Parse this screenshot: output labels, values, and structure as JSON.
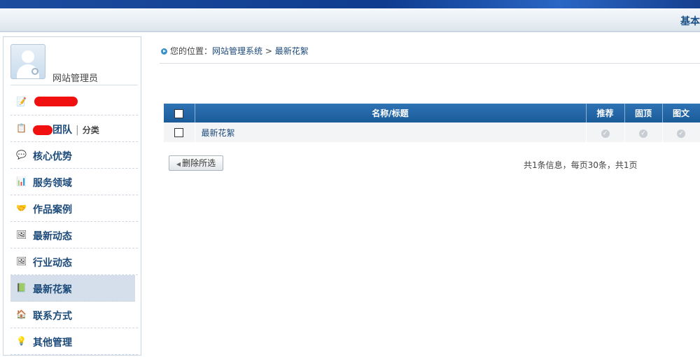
{
  "header": {
    "right_label": "基本"
  },
  "sidebar": {
    "user_name": "网站管理员",
    "items": [
      {
        "label": "",
        "icon": "edit-icon",
        "redacted": true
      },
      {
        "label": "团队",
        "sub": "分类",
        "icon": "team-icon",
        "redacted": true
      },
      {
        "label": "核心优势",
        "icon": "chat-icon"
      },
      {
        "label": "服务领域",
        "icon": "chart-icon"
      },
      {
        "label": "作品案例",
        "icon": "handshake-icon"
      },
      {
        "label": "最新动态",
        "icon": "picture-icon"
      },
      {
        "label": "行业动态",
        "icon": "picture-icon"
      },
      {
        "label": "最新花絮",
        "icon": "note-icon",
        "active": true
      },
      {
        "label": "联系方式",
        "icon": "house-icon"
      },
      {
        "label": "其他管理",
        "icon": "bulb-icon"
      }
    ]
  },
  "breadcrumb": {
    "prefix": "您的位置：",
    "system": "网站管理系统",
    "sep": ">",
    "current": "最新花絮"
  },
  "table": {
    "headers": [
      "名称/标题",
      "推荐",
      "固顶",
      "图文"
    ],
    "rows": [
      {
        "title": "最新花絮"
      }
    ]
  },
  "actions": {
    "delete_label": "删除所选"
  },
  "pager": {
    "text": "共1条信息，每页30条，共1页"
  },
  "colors": {
    "header_blue": "#1b5b9a",
    "link": "#1c4a79",
    "active_bg": "#d4dfeb"
  }
}
